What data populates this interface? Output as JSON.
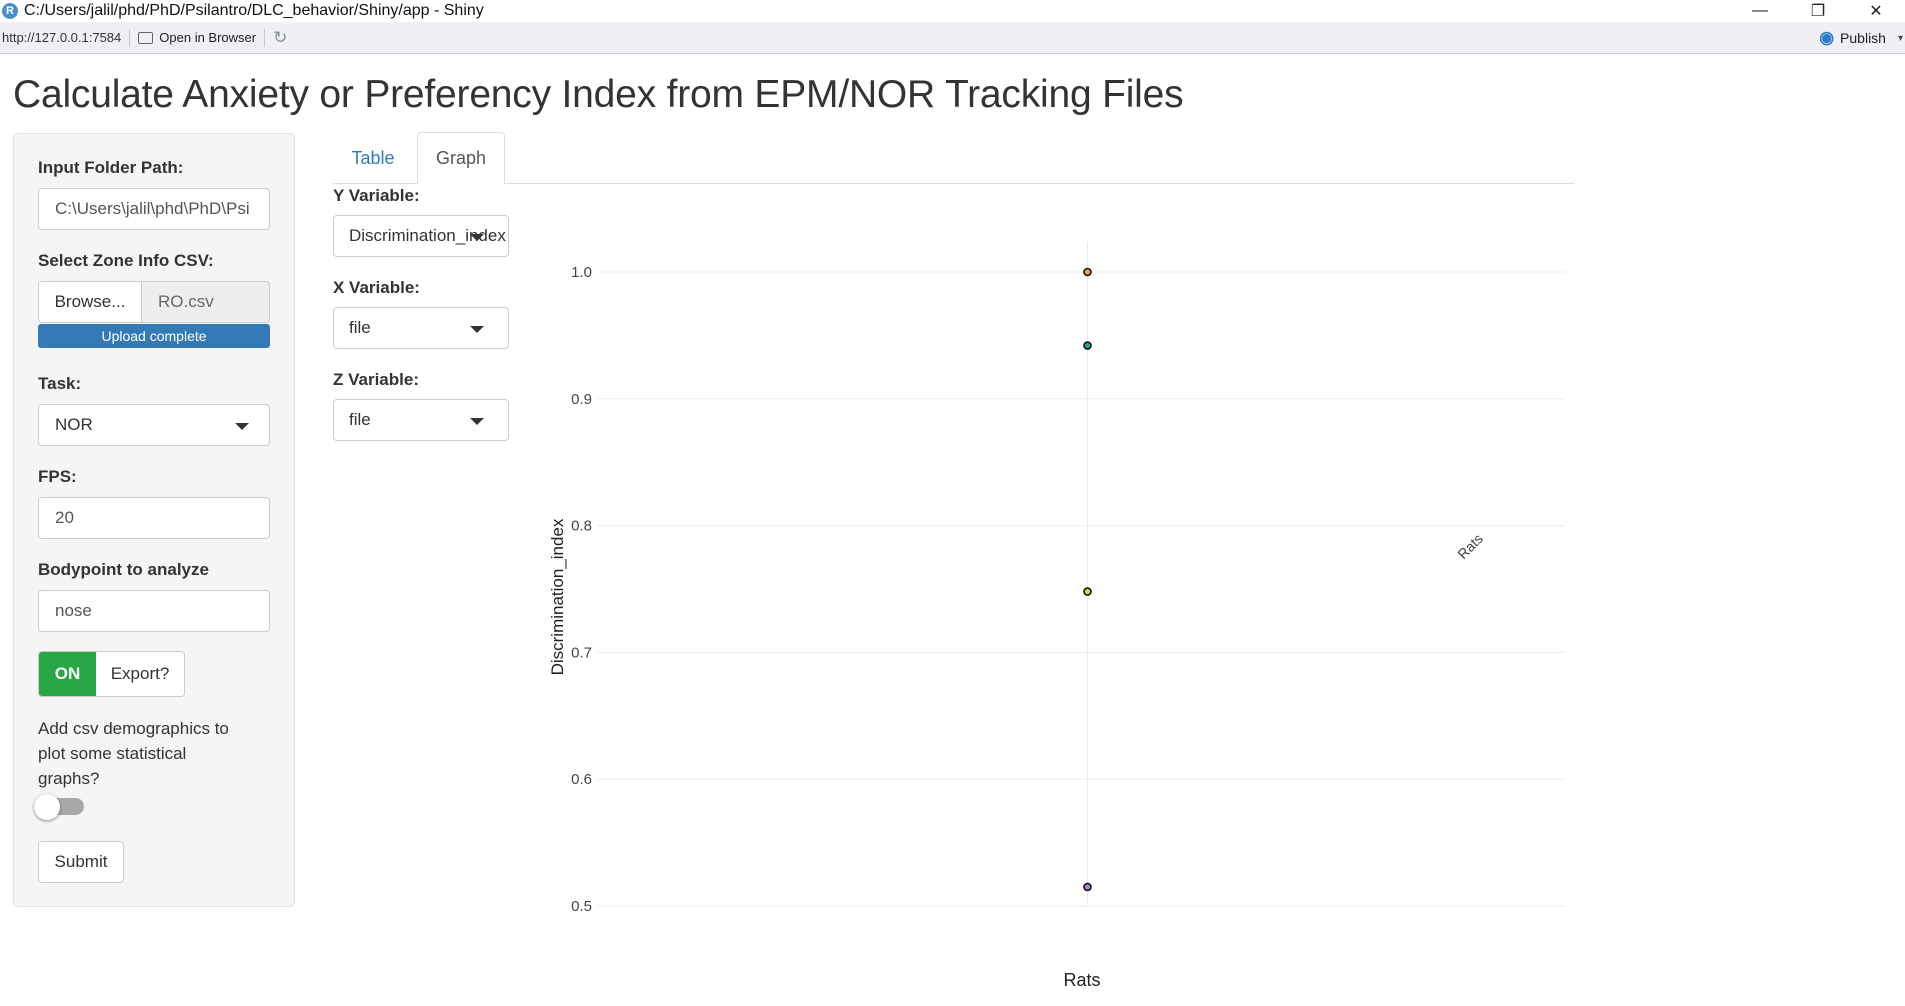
{
  "window": {
    "title": "C:/Users/jalil/phd/PhD/Psilantro/DLC_behavior/Shiny/app - Shiny",
    "logo_letter": "R",
    "minimize_glyph": "—",
    "maximize_glyph": "❐",
    "close_glyph": "✕"
  },
  "addressbar": {
    "url": "http://127.0.0.1:7584",
    "open_in_browser": "Open in Browser",
    "refresh_glyph": "↻",
    "publish": "Publish",
    "publish_glyph": "◉",
    "publish_caret": "▾"
  },
  "page": {
    "title": "Calculate Anxiety or Preferency Index from EPM/NOR Tracking Files"
  },
  "sidebar": {
    "folder_label": "Input Folder Path:",
    "folder_value": "C:\\Users\\jalil\\phd\\PhD\\Psi",
    "zone_label": "Select Zone Info CSV:",
    "browse_label": "Browse...",
    "zone_file": "RO.csv",
    "upload_status": "Upload complete",
    "task_label": "Task:",
    "task_value": "NOR",
    "fps_label": "FPS:",
    "fps_value": "20",
    "bodypoint_label": "Bodypoint to analyze",
    "bodypoint_value": "nose",
    "export_on": "ON",
    "export_label": "Export?",
    "demographics_text": "Add csv demographics to plot some statistical graphs?",
    "demographics_enabled": false,
    "submit_label": "Submit"
  },
  "tabs": {
    "items": [
      {
        "label": "Table",
        "active": false
      },
      {
        "label": "Graph",
        "active": true
      }
    ]
  },
  "controls": {
    "y_label": "Y Variable:",
    "y_value": "Discrimination_index",
    "x_label": "X Variable:",
    "x_value": "file",
    "z_label": "Z Variable:",
    "z_value": "file"
  },
  "chart_data": {
    "type": "scatter",
    "xlabel": "Rats",
    "ylabel": "Discrimination_index",
    "categories": [
      "Rats"
    ],
    "ylim": [
      0.5,
      1.0
    ],
    "yticks": [
      0.5,
      0.6,
      0.7,
      0.8,
      0.9,
      1.0
    ],
    "grid": true,
    "points": [
      {
        "x": "Rats",
        "y": 1.0,
        "color": "#f2a33a"
      },
      {
        "x": "Rats",
        "y": 0.942,
        "color": "#21a5a0"
      },
      {
        "x": "Rats",
        "y": 0.748,
        "color": "#d6d93a"
      },
      {
        "x": "Rats",
        "y": 0.515,
        "color": "#b37fe0"
      }
    ]
  }
}
